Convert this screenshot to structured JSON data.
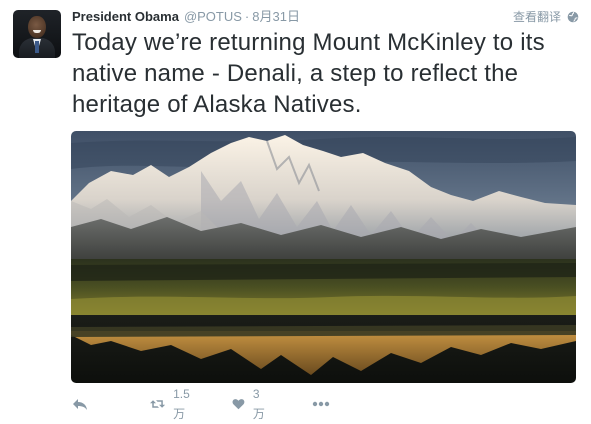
{
  "tweet": {
    "name": "President Obama",
    "handle": "@POTUS",
    "separator": "·",
    "time": "8月31日",
    "translate_label": "查看翻译",
    "text": "Today we’re returning Mount McKinley to its native name - Denali, a step to reflect the heritage of Alaska Natives.",
    "media": {
      "icon": "denali-mountain-photo"
    },
    "actions": {
      "reply_icon": "reply-icon",
      "retweet_count": "1.5万",
      "like_count": "3万",
      "more_icon": "more-icon"
    }
  },
  "colors": {
    "text": "#292f33",
    "muted": "#8899a6",
    "background": "#ffffff"
  }
}
